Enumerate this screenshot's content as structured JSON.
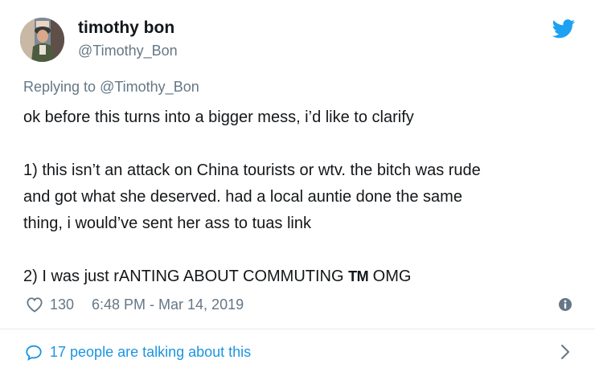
{
  "user": {
    "display_name": "timothy bon",
    "handle": "@Timothy_Bon"
  },
  "reply": {
    "prefix": "Replying to ",
    "handle": "@Timothy_Bon"
  },
  "tweet": {
    "line1": "ok before this turns into a bigger mess, i’d like to clarify",
    "line2": "1) this isn’t an attack on China tourists or wtv. the bitch was rude",
    "line3": "and got what she deserved. had a local auntie done the same",
    "line4": "thing, i would’ve sent her ass to tuas link",
    "line5_text": "2) I was just rANTING ABOUT COMMUTING ",
    "line5_tm": "TM",
    "line5_end": " OMG"
  },
  "meta": {
    "likes": "130",
    "timestamp": "6:48 PM - Mar 14, 2019"
  },
  "conversation": {
    "label": "17 people are talking about this"
  },
  "icons": {
    "brand": "twitter-bird-icon",
    "like": "heart-icon",
    "info": "info-icon",
    "conversation": "speech-bubble-icon",
    "navigate": "chevron-right-icon"
  },
  "colors": {
    "twitter_blue": "#1da1f2",
    "link_blue": "#1b95e0",
    "text_primary": "#14171a",
    "text_secondary": "#657786",
    "divider": "#e6ecf0"
  }
}
